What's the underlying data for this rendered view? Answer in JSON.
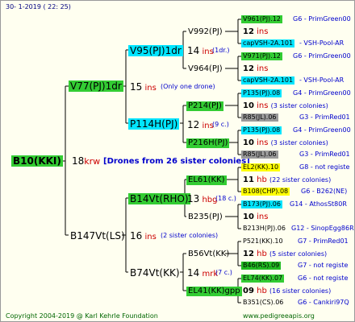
{
  "header": "30-   1-2019  (  22:  25)",
  "footer_left": "Copyright 2004-2019 @ Karl Kehrle Foundation",
  "footer_right": "www.pedigreeapis.org",
  "root": {
    "name": "B10(KKI)"
  },
  "gen1": {
    "num": "18",
    "ins": "krw",
    "note": "[Drones from 26 sister colonies]",
    "top": {
      "name": "V77(PJ)1dr"
    },
    "bottom": {
      "name": "B147Vt(LS)"
    }
  },
  "gen2": {
    "top": {
      "num": "15",
      "ins": "ins",
      "note": "(Only one drone)",
      "a": {
        "name": "V95(PJ)1dr"
      },
      "b": {
        "name": "P114H(PJ)"
      }
    },
    "bottom": {
      "num": "16",
      "ins": "ins",
      "note": "(2 sister colonies)",
      "a": {
        "name": "B14Vt(RHO)"
      },
      "b": {
        "name": "B74Vt(KK)"
      }
    }
  },
  "gen3": [
    {
      "num": "14",
      "ins": "ins",
      "note": "(1dr.)",
      "a": "V992(PJ)",
      "b": "V964(PJ)"
    },
    {
      "num": "12",
      "ins": "ins",
      "note": "(9 c.)",
      "a": "P214(PJ)",
      "b": "P216H(PJ)"
    },
    {
      "num": "13",
      "ins": "hbg",
      "note": "(18 c.)",
      "a": "EL61(KK)",
      "b": "B235(PJ)"
    },
    {
      "num": "14",
      "ins": "mrk",
      "note": "(7 c.)",
      "a": "B56Vt(KK)",
      "b": "EL41(KK)gpp"
    }
  ],
  "gen4": [
    {
      "top": "V961(PJ).12",
      "top_src": "G6 - PrimGreen00",
      "num": "12",
      "ins": "ins",
      "note": "",
      "bot": "capVSH-2A.101",
      "bot_src": "- VSH-Pool-AR"
    },
    {
      "top": "V971(PJ).12",
      "top_src": "G6 - PrimGreen00",
      "num": "12",
      "ins": "ins",
      "note": "",
      "bot": "capVSH-2A.101",
      "bot_src": "- VSH-Pool-AR"
    },
    {
      "top": "P135(PJ).08",
      "top_src": "G4 - PrimGreen00",
      "num": "10",
      "ins": "ins",
      "note": "(3 sister colonies)",
      "bot": "R85(JL).06",
      "bot_src": "G3 - PrimRed01"
    },
    {
      "top": "P135(PJ).08",
      "top_src": "G4 - PrimGreen00",
      "num": "10",
      "ins": "ins",
      "note": "(3 sister colonies)",
      "bot": "R85(JL).06",
      "bot_src": "G3 - PrimRed01"
    },
    {
      "top": "EL2(KK).10",
      "top_src": "G8 - not registe",
      "num": "11",
      "ins": "hb",
      "note": "(22 sister colonies)",
      "bot": "B108(CHP).08",
      "bot_src": "G6 - B262(NE)"
    },
    {
      "top": "B173(PJ).06",
      "top_src": "G14 - AthosSt80R",
      "num": "10",
      "ins": "ins",
      "note": "",
      "bot": "B213H(PJ).06",
      "bot_src": "G12 - SinopEgg86R"
    },
    {
      "top": "P521(KK).10",
      "top_src": "G7 - PrimRed01",
      "num": "12",
      "ins": "hb",
      "note": "(5 sister colonies)",
      "bot": "B46(RS).09",
      "bot_src": "G7 - not registe"
    },
    {
      "top": "EL74(KK).07",
      "top_src": "G6 - not registe",
      "num": "09",
      "ins": "hb",
      "note": "(16 sister colonies)",
      "bot": "B351(CS).06",
      "bot_src": "G6 - Cankiri97Q"
    }
  ]
}
